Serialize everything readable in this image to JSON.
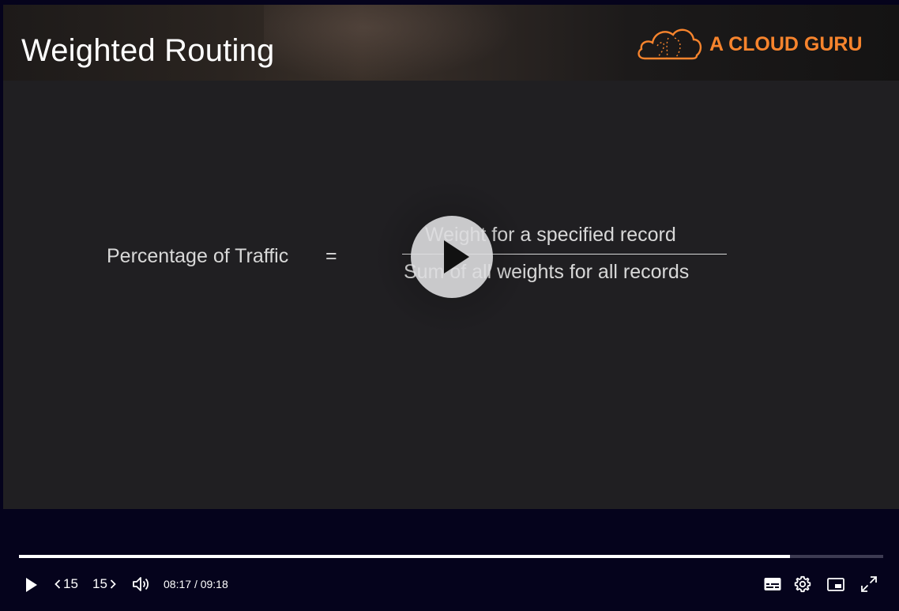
{
  "slide": {
    "title": "Weighted Routing",
    "logo_text": "A CLOUD GURU",
    "brand_color": "#f7842d",
    "formula": {
      "lhs": "Percentage of Traffic",
      "equals": "=",
      "numerator": "Weight for a specified record",
      "denominator": "Sum of all weights for all records"
    }
  },
  "player": {
    "big_play_icon": "play-icon",
    "progress_fraction": 0.892,
    "controls": {
      "play_icon": "play-icon",
      "rewind_label": "15",
      "rewind_icon": "chevron-left-icon",
      "forward_label": "15",
      "forward_icon": "chevron-right-icon",
      "volume_icon": "volume-icon",
      "current_time": "08:17",
      "separator": "/",
      "duration": "09:18",
      "captions_icon": "captions-icon",
      "settings_icon": "gear-icon",
      "pip_icon": "picture-in-picture-icon",
      "fullscreen_icon": "fullscreen-icon"
    }
  }
}
